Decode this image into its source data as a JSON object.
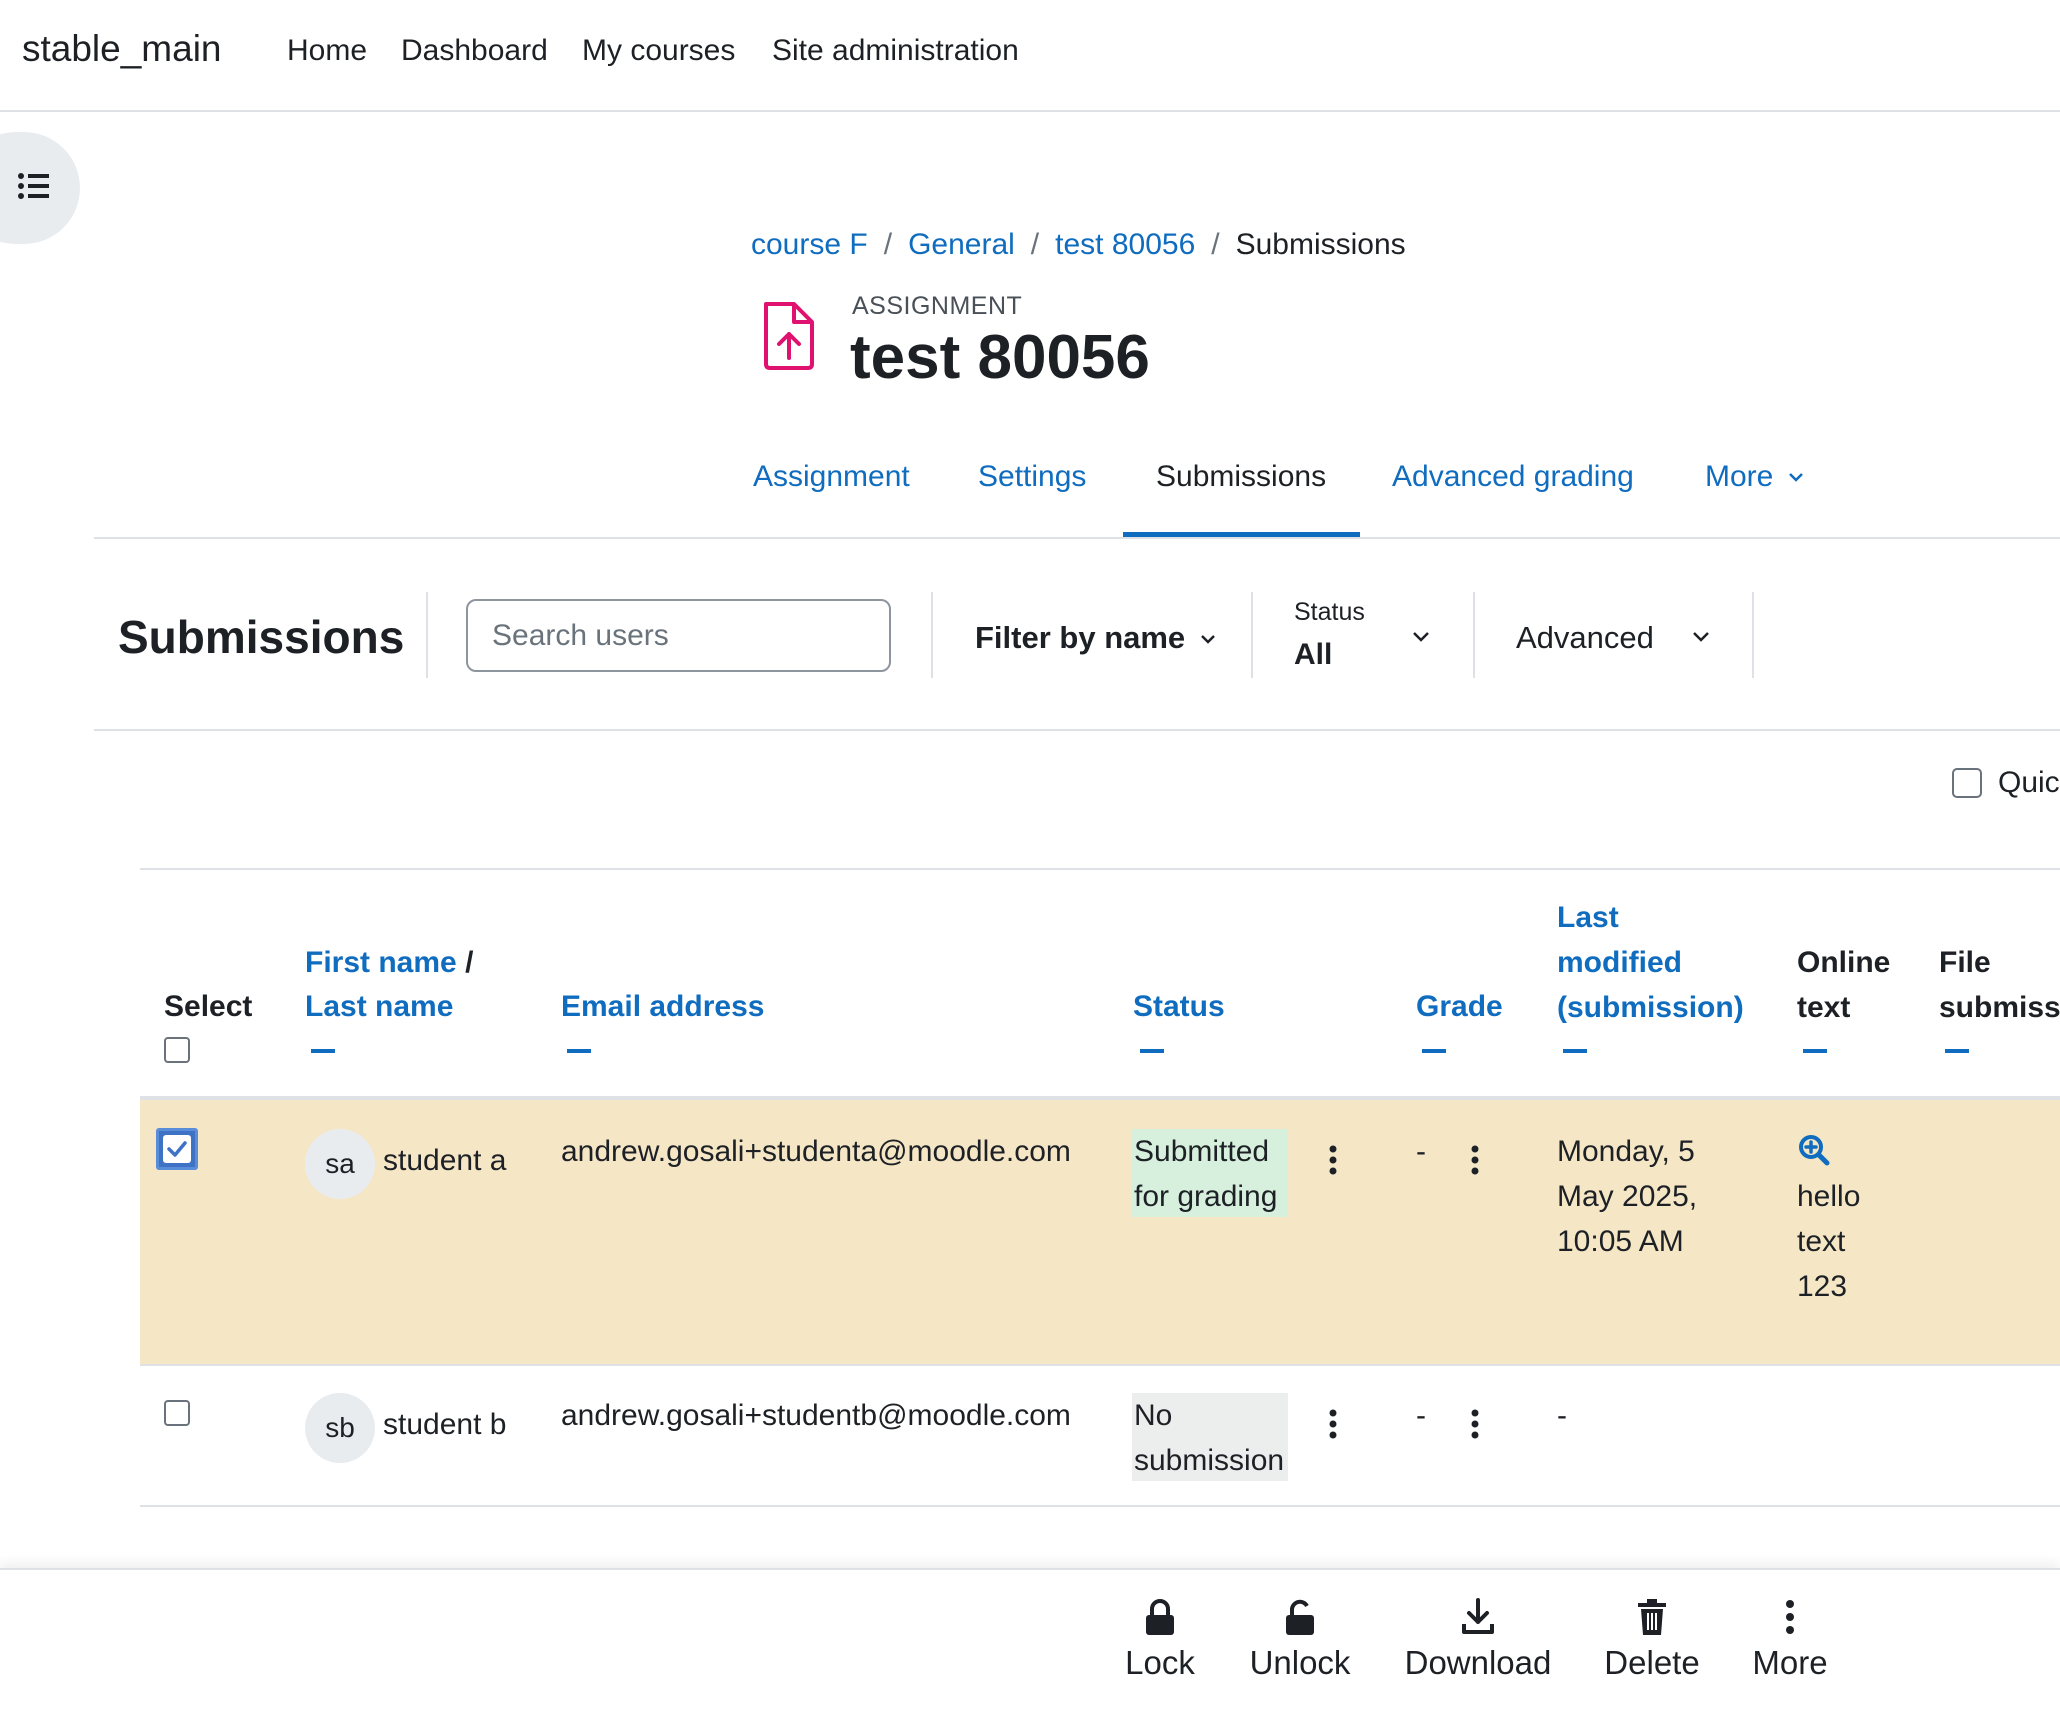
{
  "navbar": {
    "brand": "stable_main",
    "items": [
      "Home",
      "Dashboard",
      "My courses",
      "Site administration"
    ]
  },
  "breadcrumb": [
    "course F",
    "General",
    "test 80056",
    "Submissions"
  ],
  "header": {
    "activity_type": "ASSIGNMENT",
    "title": "test 80056"
  },
  "tabs": [
    "Assignment",
    "Settings",
    "Submissions",
    "Advanced grading",
    "More"
  ],
  "filters": {
    "heading": "Submissions",
    "search_placeholder": "Search users",
    "filter_by_name": "Filter by name",
    "status_label": "Status",
    "status_value": "All",
    "advanced": "Advanced"
  },
  "quick_grading_label": "Quic",
  "table": {
    "headers": {
      "select": "Select",
      "first_name": "First name",
      "name_sep": "/",
      "last_name": "Last name",
      "email": "Email address",
      "status": "Status",
      "grade": "Grade",
      "last_modified_1": "Last",
      "last_modified_2": "modified",
      "last_modified_3": "(submission)",
      "online_text_1": "Online",
      "online_text_2": "text",
      "file_sub_1": "File",
      "file_sub_2": "submiss"
    },
    "rows": [
      {
        "selected": true,
        "initials": "sa",
        "name": "student a",
        "email": "andrew.gosali+studenta@moodle.com",
        "status_1": "Submitted",
        "status_2": "for grading",
        "status_color": "#d7f0dd",
        "grade": "-",
        "modified_1": "Monday, 5",
        "modified_2": "May 2025,",
        "modified_3": "10:05 AM",
        "online_1": "hello",
        "online_2": "text",
        "online_3": "123"
      },
      {
        "selected": false,
        "initials": "sb",
        "name": "student b",
        "email": "andrew.gosali+studentb@moodle.com",
        "status_1": "No",
        "status_2": "submission",
        "status_color": "#eceded",
        "grade": "-",
        "modified_1": "-"
      }
    ]
  },
  "footer": [
    "Lock",
    "Unlock",
    "Download",
    "Delete",
    "More"
  ],
  "colors": {
    "accent": "#0f6cbf",
    "selected_row": "#f5e6c6",
    "activity_icon": "#e0126f"
  }
}
